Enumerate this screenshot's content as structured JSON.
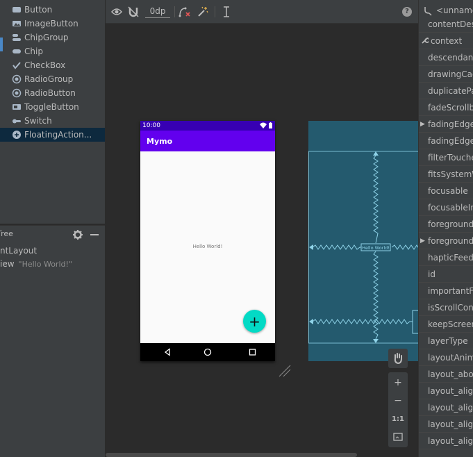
{
  "palette": {
    "items": [
      {
        "label": "Button",
        "icon": "button-icon"
      },
      {
        "label": "ImageButton",
        "icon": "image-button-icon"
      },
      {
        "label": "ChipGroup",
        "icon": "chip-group-icon"
      },
      {
        "label": "Chip",
        "icon": "chip-icon"
      },
      {
        "label": "CheckBox",
        "icon": "checkbox-icon"
      },
      {
        "label": "RadioGroup",
        "icon": "radio-group-icon"
      },
      {
        "label": "RadioButton",
        "icon": "radio-button-icon"
      },
      {
        "label": "ToggleButton",
        "icon": "toggle-button-icon"
      },
      {
        "label": "Switch",
        "icon": "switch-icon"
      },
      {
        "label": "FloatingAction...",
        "icon": "fab-icon"
      }
    ]
  },
  "component_tree": {
    "title": "Tree",
    "rows": [
      {
        "label": "ntLayout",
        "detail": ""
      },
      {
        "label": "iew",
        "detail": "\"Hello World!\""
      }
    ]
  },
  "toolbar": {
    "default_margin": "0dp",
    "help": "?"
  },
  "phone": {
    "time": "10:00",
    "app_title": "Mymo",
    "hello_text": "Hello World!",
    "fab_symbol": "+"
  },
  "blueprint": {
    "hello_text": "Hello World!"
  },
  "zoom": {
    "zoom_in": "+",
    "zoom_out": "−",
    "actual_size": "1:1"
  },
  "attributes": {
    "header": "<unnamed>",
    "rows": [
      {
        "label": "contentDesc",
        "kind": "plain"
      },
      {
        "label": "context",
        "kind": "wrench"
      },
      {
        "label": "descendantF",
        "kind": "plain"
      },
      {
        "label": "drawingCach",
        "kind": "plain"
      },
      {
        "label": "duplicatePar",
        "kind": "plain"
      },
      {
        "label": "fadeScrollba",
        "kind": "plain"
      },
      {
        "label": "fadingEdge",
        "kind": "expand"
      },
      {
        "label": "fadingEdgeL",
        "kind": "plain"
      },
      {
        "label": "filterTouche",
        "kind": "plain"
      },
      {
        "label": "fitsSystemW",
        "kind": "plain"
      },
      {
        "label": "focusable",
        "kind": "plain"
      },
      {
        "label": "focusableInT",
        "kind": "plain"
      },
      {
        "label": "foreground",
        "kind": "plain"
      },
      {
        "label": "foregroundC",
        "kind": "expand"
      },
      {
        "label": "hapticFeedb",
        "kind": "plain"
      },
      {
        "label": "id",
        "kind": "plain"
      },
      {
        "label": "importantFo",
        "kind": "plain"
      },
      {
        "label": "isScrollCont",
        "kind": "plain"
      },
      {
        "label": "keepScreenO",
        "kind": "plain"
      },
      {
        "label": "layerType",
        "kind": "plain"
      },
      {
        "label": "layoutAnima",
        "kind": "plain"
      },
      {
        "label": "layout_abov",
        "kind": "plain"
      },
      {
        "label": "layout_align",
        "kind": "plain"
      },
      {
        "label": "layout_align",
        "kind": "plain"
      },
      {
        "label": "layout_align",
        "kind": "plain"
      },
      {
        "label": "layout_align",
        "kind": "plain"
      }
    ]
  },
  "colors": {
    "status_bar": "#3700b3",
    "app_bar": "#6200ee",
    "fab": "#03dac5",
    "blueprint": "#245a6e",
    "selection": "#0d293e"
  }
}
